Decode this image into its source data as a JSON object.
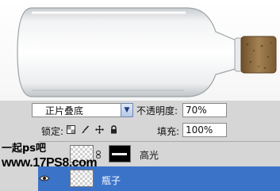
{
  "layers_panel": {
    "blend_mode": "正片叠底",
    "opacity_label": "不透明度:",
    "opacity_value": "70%",
    "lock_label": "锁定:",
    "fill_label": "填充:",
    "fill_value": "100%",
    "lock_icons": [
      "transparency-lock-icon",
      "brush-lock-icon",
      "move-lock-icon",
      "padlock-icon"
    ],
    "layers": [
      {
        "name": "高光",
        "selected": false,
        "has_mask": true
      },
      {
        "name": "瓶子",
        "selected": true,
        "has_mask": false
      }
    ]
  },
  "watermark": {
    "line1": "一起ps吧",
    "line2": "www.17PS8.com"
  },
  "colors": {
    "selection": "#3b73c9",
    "panel_bg": "#d6d6d6",
    "cork": "#8a6a3d"
  }
}
